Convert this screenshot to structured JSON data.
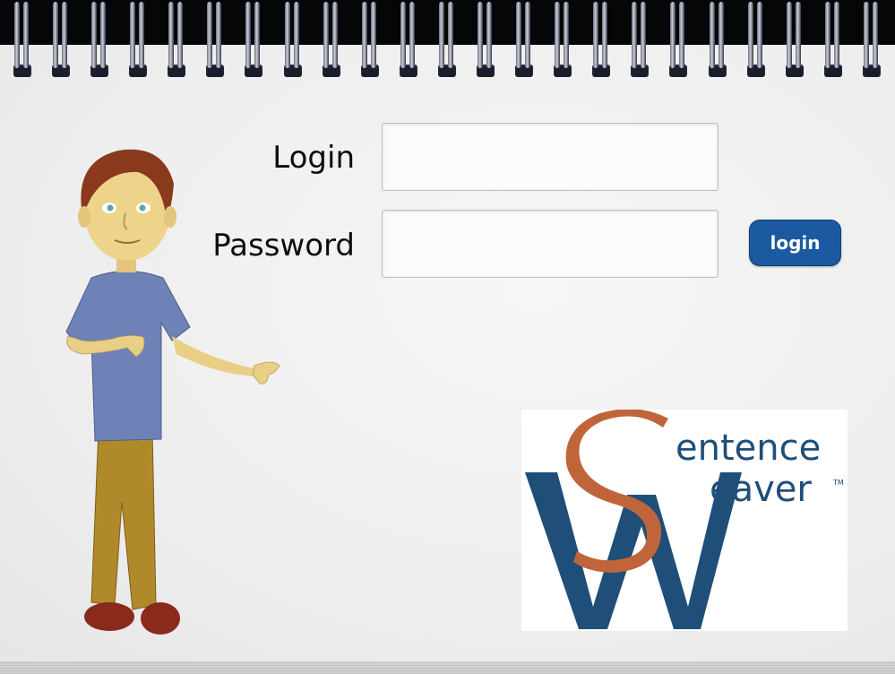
{
  "form": {
    "login_label": "Login",
    "password_label": "Password",
    "login_value": "",
    "password_value": "",
    "button_label": "login"
  },
  "logo": {
    "word1": "entence",
    "word2": "eaver",
    "tm": "TM",
    "colors": {
      "blue": "#1f4e79",
      "orange": "#c0643a"
    }
  },
  "theme": {
    "button_blue": "#1b5aa0"
  }
}
